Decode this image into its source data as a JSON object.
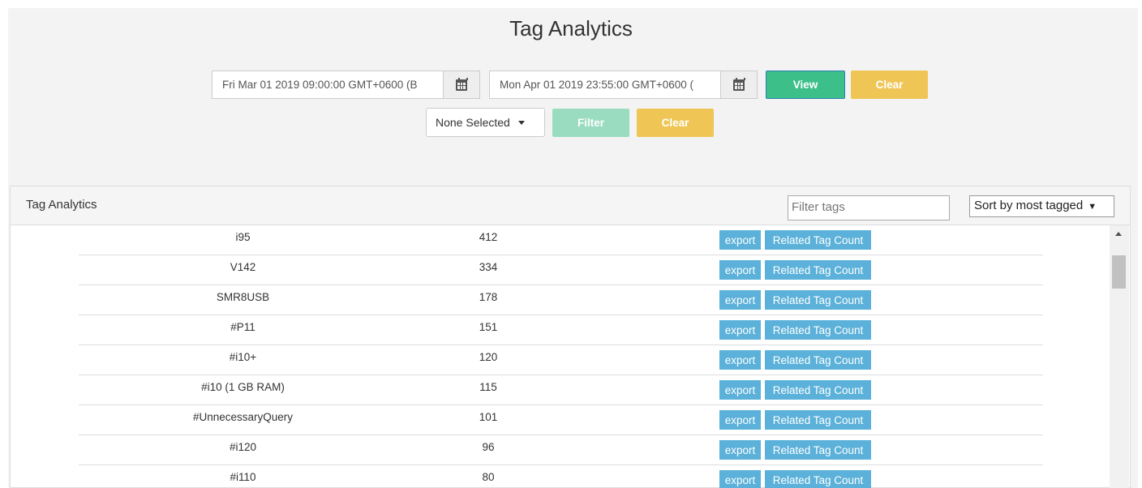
{
  "page": {
    "title": "Tag Analytics"
  },
  "date_range": {
    "start_value": "Fri Mar 01 2019 09:00:00 GMT+0600 (B",
    "end_value": "Mon Apr 01 2019 23:55:00 GMT+0600 (",
    "calendar_icon": "calendar-icon",
    "view_label": "View",
    "clear_label": "Clear"
  },
  "filter": {
    "select_value": "None Selected",
    "filter_label": "Filter",
    "clear_label": "Clear"
  },
  "panel": {
    "title": "Tag Analytics",
    "filter_placeholder": "Filter tags",
    "sort_value": "Sort by most tagged"
  },
  "rows": [
    {
      "tag": "i95",
      "count": "412",
      "export_label": "export",
      "related_label": "Related Tag Count"
    },
    {
      "tag": "V142",
      "count": "334",
      "export_label": "export",
      "related_label": "Related Tag Count"
    },
    {
      "tag": "SMR8USB",
      "count": "178",
      "export_label": "export",
      "related_label": "Related Tag Count"
    },
    {
      "tag": "#P11",
      "count": "151",
      "export_label": "export",
      "related_label": "Related Tag Count"
    },
    {
      "tag": "#i10+",
      "count": "120",
      "export_label": "export",
      "related_label": "Related Tag Count"
    },
    {
      "tag": "#i10 (1 GB RAM)",
      "count": "115",
      "export_label": "export",
      "related_label": "Related Tag Count"
    },
    {
      "tag": "#UnnecessaryQuery",
      "count": "101",
      "export_label": "export",
      "related_label": "Related Tag Count"
    },
    {
      "tag": "#i120",
      "count": "96",
      "export_label": "export",
      "related_label": "Related Tag Count"
    },
    {
      "tag": "#i110",
      "count": "80",
      "export_label": "export",
      "related_label": "Related Tag Count"
    }
  ],
  "colors": {
    "view": "#3dbf8a",
    "clear": "#efc655",
    "filter_disabled": "#9adcc0",
    "row_button": "#5bb1d9"
  }
}
